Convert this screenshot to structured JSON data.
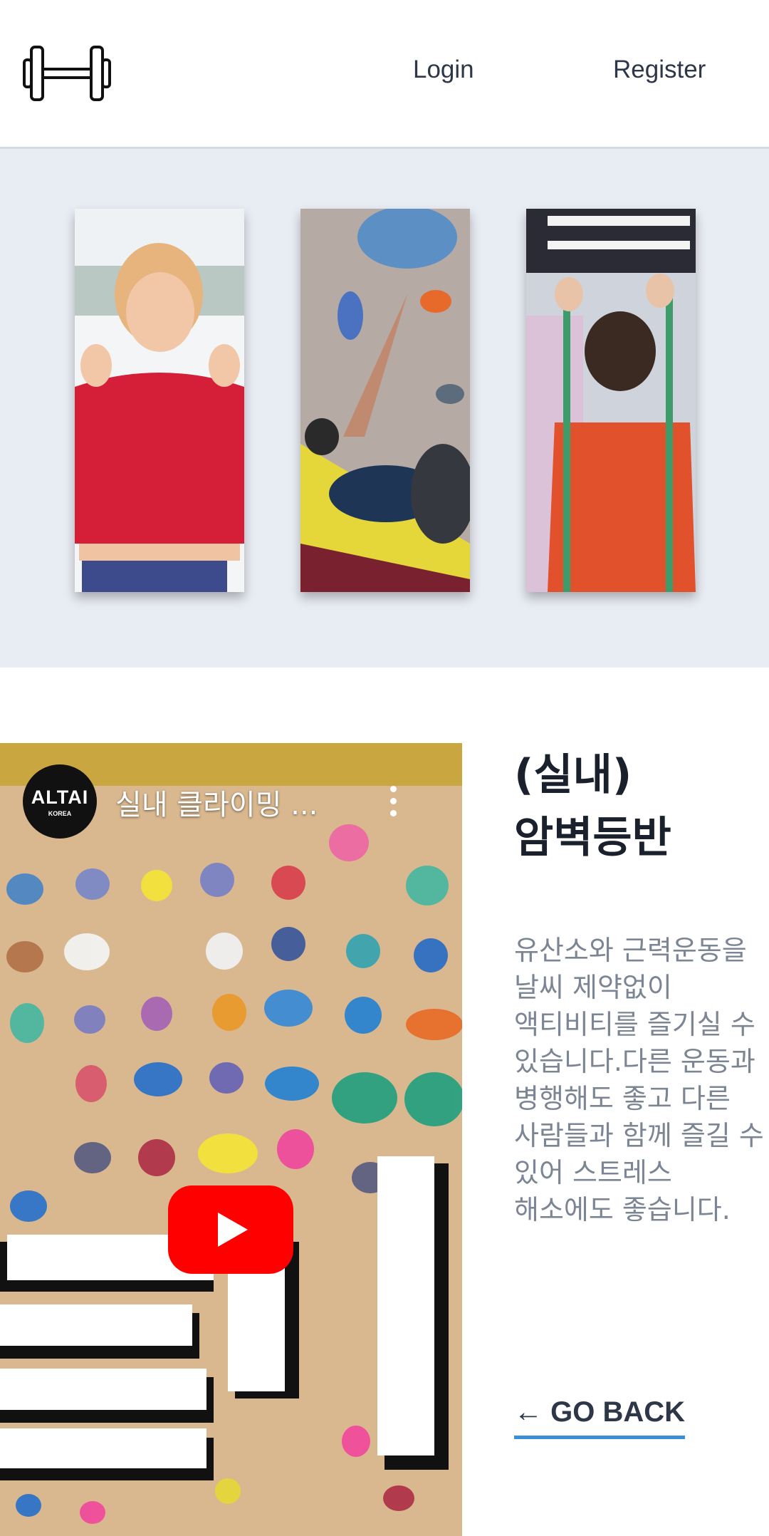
{
  "header": {
    "logo_icon": "dumbbell-icon",
    "login_label": "Login",
    "register_label": "Register"
  },
  "gallery": {
    "photos": [
      {
        "subject": "child-flexing-photo"
      },
      {
        "subject": "woman-bouldering-photo"
      },
      {
        "subject": "woman-resistance-band-photo"
      }
    ]
  },
  "video": {
    "channel_name": "ALTAI",
    "channel_sub": "KOREA",
    "title": "실내 클라이밍 ...",
    "overlay_text": "클라",
    "play_icon": "youtube-play-icon",
    "menu_icon": "more-vertical-icon"
  },
  "content": {
    "title_line1": "(실내)",
    "title_line2": "암벽등반",
    "description": "유산소와 근력운동을 날씨 제약없이 액티비티를 즐기실 수 있습니다.다른 운동과 병행해도 좋고 다른 사람들과 함께 즐길 수 있어 스트레스 해소에도 좋습니다.",
    "go_back_label": "← GO BACK"
  },
  "colors": {
    "gallery_bg": "#e8ecf3",
    "accent_underline": "#3b8fd6",
    "youtube_red": "#ff0000"
  }
}
